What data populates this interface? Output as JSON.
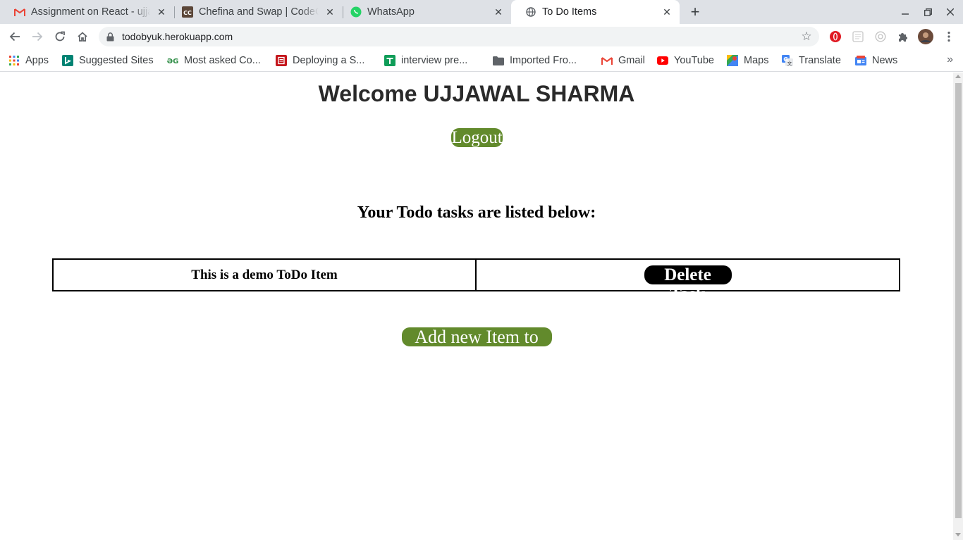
{
  "browser": {
    "tabs": [
      {
        "title": "Assignment on React - ujjawal",
        "favicon": "gmail-icon"
      },
      {
        "title": "Chefina and Swap | CodeChef",
        "favicon": "codechef-icon"
      },
      {
        "title": "WhatsApp",
        "favicon": "whatsapp-icon"
      },
      {
        "title": "To Do Items",
        "favicon": "globe-icon",
        "active": true
      }
    ],
    "new_tab": "+",
    "url": "todobyuk.herokuapp.com",
    "bookmarks": [
      {
        "label": "Apps",
        "icon": "apps-grid-icon"
      },
      {
        "label": "Suggested Sites",
        "icon": "bing-icon"
      },
      {
        "label": "Most asked Co...",
        "icon": "geeksforgeeks-icon"
      },
      {
        "label": "Deploying a S...",
        "icon": "red-doc-icon"
      },
      {
        "label": "interview pre...",
        "icon": "green-sheet-icon"
      },
      {
        "label": "Imported Fro...",
        "icon": "folder-icon"
      },
      {
        "label": "Gmail",
        "icon": "gmail-icon"
      },
      {
        "label": "YouTube",
        "icon": "youtube-icon"
      },
      {
        "label": "Maps",
        "icon": "maps-icon"
      },
      {
        "label": "Translate",
        "icon": "translate-icon"
      },
      {
        "label": "News",
        "icon": "news-icon"
      }
    ],
    "more_bookmarks": "»"
  },
  "page": {
    "welcome": "Welcome UJJAWAL SHARMA",
    "logout_label": "Logout",
    "subtitle": "Your Todo tasks are listed below:",
    "todos": [
      {
        "text": "This is a demo ToDo Item",
        "action_label": "Delete Task"
      }
    ],
    "add_label": "Add new Item to List"
  },
  "colors": {
    "accent_green": "#628a2c",
    "delete_black": "#000000"
  }
}
